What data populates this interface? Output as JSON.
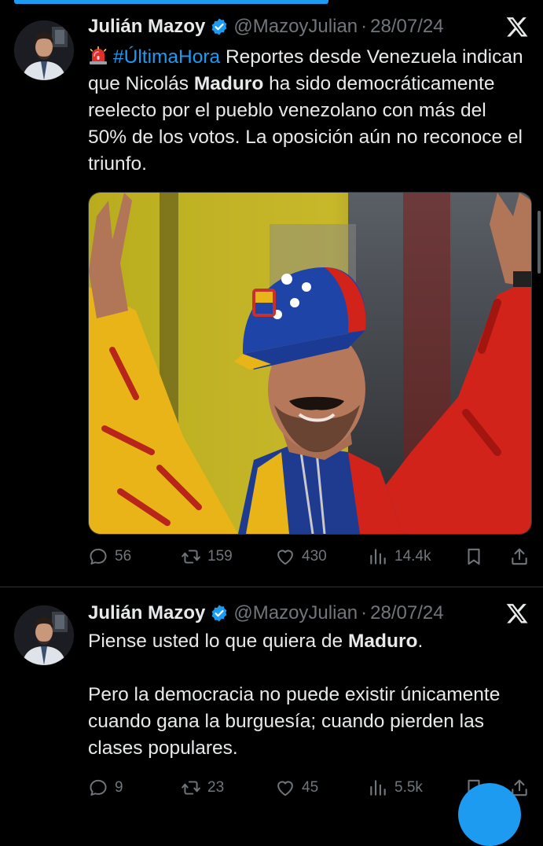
{
  "colors": {
    "background": "#000000",
    "text": "#e7e9ea",
    "muted": "#71767b",
    "accent": "#1d9bf0",
    "divider": "#2f3336"
  },
  "tweets": [
    {
      "author": {
        "name": "Julián Mazoy",
        "handle": "@MazoyJulian",
        "verified_icon": "verified-badge-icon"
      },
      "separator": "·",
      "date": "28/07/24",
      "platform_icon": "x-logo-icon",
      "text": {
        "emoji_icon": "siren-icon",
        "hashtag": "#ÚltimaHora",
        "part1": " Reportes desde Venezuela indican que Nicolás ",
        "bold": "Maduro",
        "part2": " ha sido democráticamente reelecto por el pueblo venezolano con más del 50% de los votos. La oposición aún no reconoce el triunfo."
      },
      "media": {
        "kind": "photo",
        "description_icon": "photo-man-in-venezuela-cap-icon"
      },
      "stats": {
        "replies": "56",
        "retweets": "159",
        "likes": "430",
        "views": "14.4k"
      }
    },
    {
      "author": {
        "name": "Julián Mazoy",
        "handle": "@MazoyJulian",
        "verified_icon": "verified-badge-icon"
      },
      "separator": "·",
      "date": "28/07/24",
      "platform_icon": "x-logo-icon",
      "text": {
        "line1_part1": "Piense usted lo que quiera de ",
        "line1_bold": "Maduro",
        "line1_part2": ".",
        "para2": "Pero la democracia no puede existir únicamente cuando gana la burguesía; cuando pierden las clases populares."
      },
      "stats": {
        "replies": "9",
        "retweets": "23",
        "likes": "45",
        "views": "5.5k"
      }
    }
  ],
  "action_icons": [
    "reply-icon",
    "retweet-icon",
    "like-icon",
    "views-icon",
    "bookmark-icon",
    "share-icon"
  ]
}
